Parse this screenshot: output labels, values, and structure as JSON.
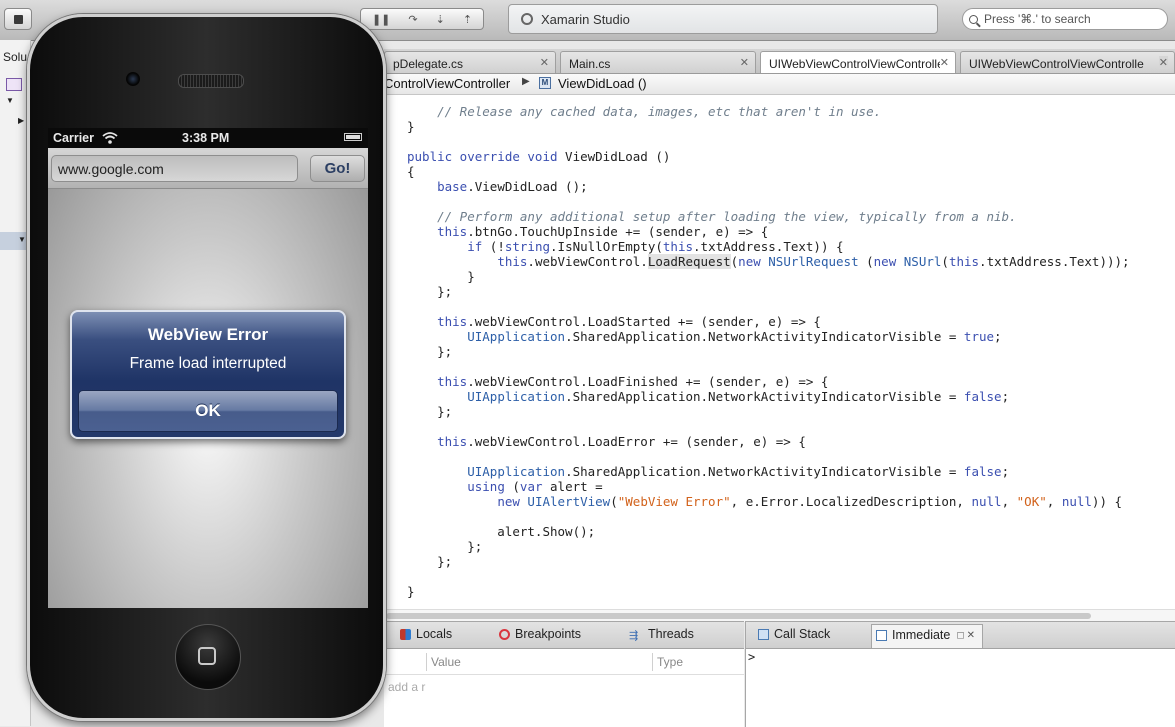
{
  "toolbar": {
    "title": "Xamarin Studio",
    "search_placeholder": "Press '⌘.' to search"
  },
  "solution_pane": {
    "label": "Solu"
  },
  "tabs": [
    {
      "label": "pDelegate.cs",
      "active": false
    },
    {
      "label": "Main.cs",
      "active": false
    },
    {
      "label": "UIWebViewControlViewControlle",
      "active": true
    },
    {
      "label": "UIWebViewControlViewControlle",
      "active": false
    }
  ],
  "breadcrumb": {
    "class_name": "ControlViewController",
    "method_icon": "M",
    "method": "ViewDidLoad ()"
  },
  "code_lines": [
    [
      {
        "t": "    "
      },
      {
        "t": "// Release any cached data, images, etc that aren't in use.",
        "c": "cm"
      }
    ],
    [
      {
        "t": "}"
      }
    ],
    [
      {
        "t": ""
      }
    ],
    [
      {
        "t": "public override void",
        "c": "kw"
      },
      {
        "t": " ViewDidLoad ()"
      }
    ],
    [
      {
        "t": "{"
      }
    ],
    [
      {
        "t": "    "
      },
      {
        "t": "base",
        "c": "kw"
      },
      {
        "t": ".ViewDidLoad ();"
      }
    ],
    [
      {
        "t": ""
      }
    ],
    [
      {
        "t": "    "
      },
      {
        "t": "// Perform any additional setup after loading the view, typically from a nib.",
        "c": "cm"
      }
    ],
    [
      {
        "t": "    "
      },
      {
        "t": "this",
        "c": "kw"
      },
      {
        "t": ".btnGo.TouchUpInside += (sender, e) => {"
      }
    ],
    [
      {
        "t": "        "
      },
      {
        "t": "if",
        "c": "kw"
      },
      {
        "t": " (!"
      },
      {
        "t": "string",
        "c": "kw"
      },
      {
        "t": ".IsNullOrEmpty("
      },
      {
        "t": "this",
        "c": "kw"
      },
      {
        "t": ".txtAddress.Text)) {"
      }
    ],
    [
      {
        "t": "            "
      },
      {
        "t": "this",
        "c": "kw"
      },
      {
        "t": ".webViewControl."
      },
      {
        "t": "LoadRequest",
        "c": "hl"
      },
      {
        "t": "("
      },
      {
        "t": "new",
        "c": "kw"
      },
      {
        "t": " "
      },
      {
        "t": "NSUrlRequest",
        "c": "ty"
      },
      {
        "t": " ("
      },
      {
        "t": "new",
        "c": "kw"
      },
      {
        "t": " "
      },
      {
        "t": "NSUrl",
        "c": "ty"
      },
      {
        "t": "("
      },
      {
        "t": "this",
        "c": "kw"
      },
      {
        "t": ".txtAddress.Text)));"
      }
    ],
    [
      {
        "t": "        }"
      }
    ],
    [
      {
        "t": "    };"
      }
    ],
    [
      {
        "t": ""
      }
    ],
    [
      {
        "t": "    "
      },
      {
        "t": "this",
        "c": "kw"
      },
      {
        "t": ".webViewControl.LoadStarted += (sender, e) => {"
      }
    ],
    [
      {
        "t": "        "
      },
      {
        "t": "UIApplication",
        "c": "ty"
      },
      {
        "t": ".SharedApplication.NetworkActivityIndicatorVisible = "
      },
      {
        "t": "true",
        "c": "kw"
      },
      {
        "t": ";"
      }
    ],
    [
      {
        "t": "    };"
      }
    ],
    [
      {
        "t": ""
      }
    ],
    [
      {
        "t": "    "
      },
      {
        "t": "this",
        "c": "kw"
      },
      {
        "t": ".webViewControl.LoadFinished += (sender, e) => {"
      }
    ],
    [
      {
        "t": "        "
      },
      {
        "t": "UIApplication",
        "c": "ty"
      },
      {
        "t": ".SharedApplication.NetworkActivityIndicatorVisible = "
      },
      {
        "t": "false",
        "c": "kw"
      },
      {
        "t": ";"
      }
    ],
    [
      {
        "t": "    };"
      }
    ],
    [
      {
        "t": ""
      }
    ],
    [
      {
        "t": "    "
      },
      {
        "t": "this",
        "c": "kw"
      },
      {
        "t": ".webViewControl.LoadError += (sender, e) => {"
      }
    ],
    [
      {
        "t": ""
      }
    ],
    [
      {
        "t": "        "
      },
      {
        "t": "UIApplication",
        "c": "ty"
      },
      {
        "t": ".SharedApplication.NetworkActivityIndicatorVisible = "
      },
      {
        "t": "false",
        "c": "kw"
      },
      {
        "t": ";"
      }
    ],
    [
      {
        "t": "        "
      },
      {
        "t": "using",
        "c": "kw"
      },
      {
        "t": " ("
      },
      {
        "t": "var",
        "c": "kw"
      },
      {
        "t": " alert ="
      }
    ],
    [
      {
        "t": "            "
      },
      {
        "t": "new",
        "c": "kw"
      },
      {
        "t": " "
      },
      {
        "t": "UIAlertView",
        "c": "ty"
      },
      {
        "t": "("
      },
      {
        "t": "\"WebView Error\"",
        "c": "st"
      },
      {
        "t": ", e.Error.LocalizedDescription, "
      },
      {
        "t": "null",
        "c": "kw"
      },
      {
        "t": ", "
      },
      {
        "t": "\"OK\"",
        "c": "st"
      },
      {
        "t": ", "
      },
      {
        "t": "null",
        "c": "kw"
      },
      {
        "t": ")) {"
      }
    ],
    [
      {
        "t": ""
      }
    ],
    [
      {
        "t": "            alert.Show();"
      }
    ],
    [
      {
        "t": "        };"
      }
    ],
    [
      {
        "t": "    };"
      }
    ],
    [
      {
        "t": ""
      }
    ],
    [
      {
        "t": "}"
      }
    ]
  ],
  "bottom_pads": {
    "locals": "Locals",
    "breakpoints": "Breakpoints",
    "threads": "Threads",
    "call_stack": "Call Stack",
    "immediate": "Immediate",
    "col_value": "Value",
    "col_type": "Type",
    "add_hint": "add a r",
    "prompt": ">"
  },
  "simulator": {
    "carrier": "Carrier",
    "time": "3:38 PM",
    "url": "www.google.com",
    "go_label": "Go!",
    "alert": {
      "title": "WebView Error",
      "message": "Frame load interrupted",
      "button": "OK"
    }
  },
  "colors": {
    "keyword": "#3b4fb0",
    "comment": "#6f7e8c",
    "type": "#2d5fa8",
    "string": "#d2621b",
    "alert_blue": "#1f3466"
  }
}
